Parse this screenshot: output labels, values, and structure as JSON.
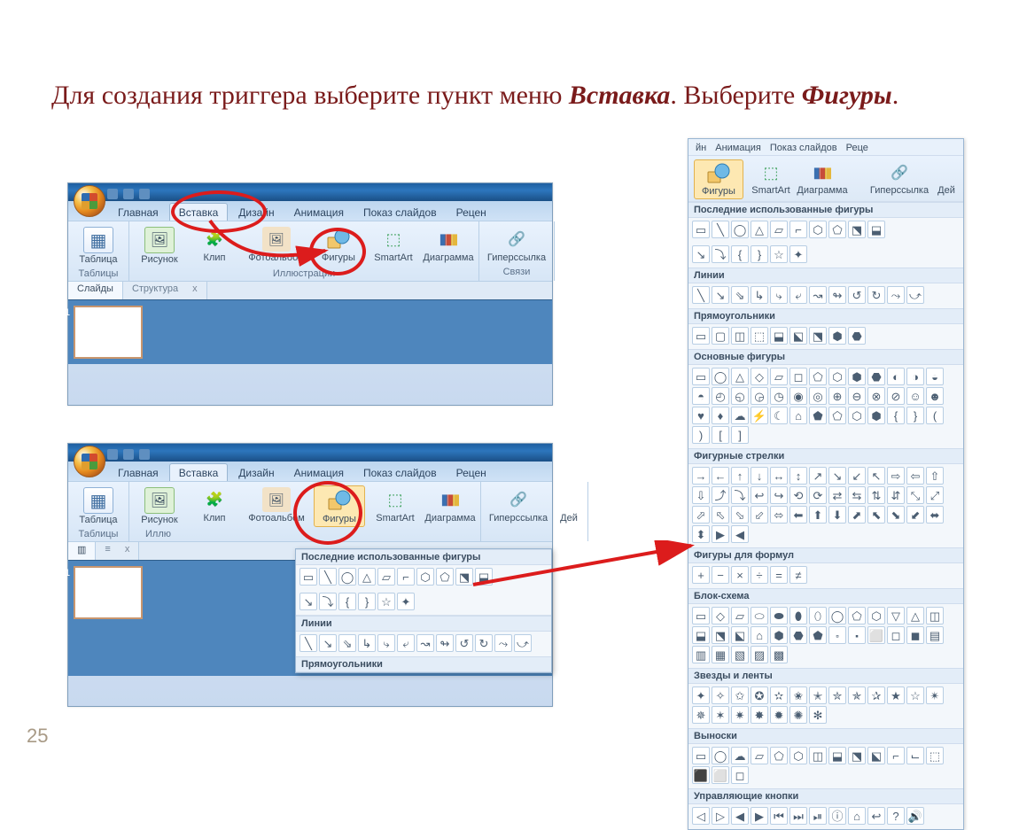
{
  "page_number": "25",
  "instruction": {
    "part1": "Для создания триггера выберите пункт меню ",
    "kw1": "Вставка",
    "part2": ". Выберите ",
    "kw2": "Фигуры",
    "part3": "."
  },
  "ribbon": {
    "tabs": [
      "Главная",
      "Вставка",
      "Дизайн",
      "Анимация",
      "Показ слайдов",
      "Рецен"
    ],
    "active_tab": "Вставка",
    "group_tables": "Таблицы",
    "group_illustrations": "Иллюстрации",
    "group_links": "Связи",
    "btn_table": "Таблица",
    "btn_picture": "Рисунок",
    "btn_clip": "Клип",
    "btn_album": "Фотоальбом",
    "btn_shapes": "Фигуры",
    "btn_smartart": "SmartArt",
    "btn_chart": "Диаграмма",
    "btn_hyperlink": "Гиперссылка",
    "btn_action": "Дей"
  },
  "pane": {
    "tab_slides": "Слайды",
    "tab_outline": "Структура",
    "close": "x"
  },
  "shapes_dropdown": {
    "recent": "Последние использованные фигуры",
    "lines": "Линии",
    "rects": "Прямоугольники",
    "basic": "Основные фигуры",
    "arrows": "Фигурные стрелки",
    "equation": "Фигуры для формул",
    "flowchart": "Блок-схема",
    "stars": "Звезды и ленты",
    "callouts": "Выноски",
    "action_buttons": "Управляющие кнопки"
  },
  "big_panel_tabs": [
    "йн",
    "Анимация",
    "Показ слайдов",
    "Реце"
  ],
  "shape_glyphs": {
    "recent": [
      "▭",
      "╲",
      "◯",
      "△",
      "▱",
      "⌐",
      "⬡",
      "⬠",
      "⬔",
      "⬓"
    ],
    "recent2": [
      "↘",
      "⤵",
      "{",
      "}",
      "☆",
      "✦"
    ],
    "lines": [
      "╲",
      "↘",
      "⇘",
      "↳",
      "⤷",
      "⤶",
      "↝",
      "↬",
      "↺",
      "↻",
      "⤳",
      "⤻"
    ],
    "rects": [
      "▭",
      "▢",
      "◫",
      "⬚",
      "⬓",
      "⬕",
      "⬔",
      "⬢",
      "⬣"
    ],
    "basic": [
      "▭",
      "◯",
      "△",
      "◇",
      "▱",
      "◻",
      "⬠",
      "⬡",
      "⬢",
      "⬣",
      "◐",
      "◑",
      "◒",
      "◓",
      "◴",
      "◵",
      "◶",
      "◷",
      "◉",
      "◎",
      "⊕",
      "⊖",
      "⊗",
      "⊘",
      "☺",
      "☻",
      "♥",
      "♦",
      "☁",
      "⚡",
      "☾",
      "⌂",
      "⬟",
      "⬠",
      "⬡",
      "⬢",
      "{",
      "}",
      "(",
      ")",
      "[",
      "]"
    ],
    "arrows": [
      "→",
      "←",
      "↑",
      "↓",
      "↔",
      "↕",
      "↗",
      "↘",
      "↙",
      "↖",
      "⇨",
      "⇦",
      "⇧",
      "⇩",
      "⤴",
      "⤵",
      "↩",
      "↪",
      "⟲",
      "⟳",
      "⇄",
      "⇆",
      "⇅",
      "⇵",
      "⤡",
      "⤢",
      "⬀",
      "⬁",
      "⬂",
      "⬃",
      "⬄",
      "⬅",
      "⬆",
      "⬇",
      "⬈",
      "⬉",
      "⬊",
      "⬋",
      "⬌",
      "⬍",
      "▶",
      "◀"
    ],
    "equation": [
      "+",
      "−",
      "×",
      "÷",
      "=",
      "≠"
    ],
    "flowchart": [
      "▭",
      "◇",
      "▱",
      "⬭",
      "⬬",
      "⬮",
      "⬯",
      "◯",
      "⬠",
      "⬡",
      "▽",
      "△",
      "◫",
      "⬓",
      "⬔",
      "⬕",
      "⌂",
      "⬢",
      "⬣",
      "⬟",
      "⬞",
      "⬝",
      "⬜",
      "◻",
      "◼",
      "▤",
      "▥",
      "▦",
      "▧",
      "▨",
      "▩"
    ],
    "stars": [
      "✦",
      "✧",
      "✩",
      "✪",
      "✫",
      "✬",
      "✭",
      "✮",
      "✯",
      "✰",
      "★",
      "☆",
      "✴",
      "✵",
      "✶",
      "✷",
      "✸",
      "✹",
      "✺",
      "✻"
    ],
    "callouts": [
      "▭",
      "◯",
      "☁",
      "▱",
      "⬠",
      "⬡",
      "◫",
      "⬓",
      "⬔",
      "⬕",
      "⌐",
      "⌙",
      "⬚",
      "⬛",
      "⬜",
      "◻"
    ],
    "action": [
      "◁",
      "▷",
      "◀",
      "▶",
      "⏮",
      "⏭",
      "⏯",
      "ⓘ",
      "⌂",
      "↩",
      "?",
      "🔊"
    ]
  }
}
